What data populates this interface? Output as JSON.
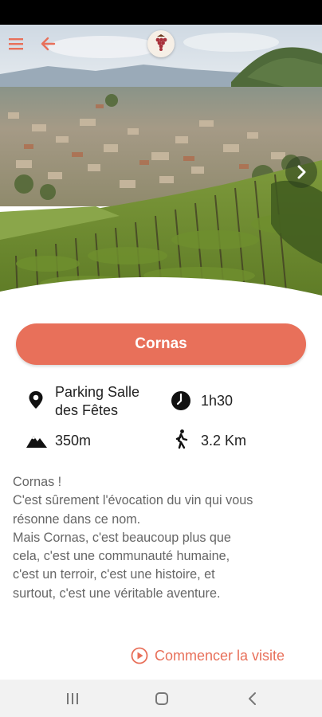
{
  "header": {
    "menu_icon": "hamburger-menu-icon",
    "back_icon": "arrow-left-icon",
    "logo_icon": "grape-logo-icon",
    "next_icon": "chevron-right-icon"
  },
  "colors": {
    "accent": "#e8705a",
    "text_dark": "#222222",
    "text_muted": "#666666"
  },
  "trail": {
    "title": "Cornas",
    "start_point": [
      "Parking Salle",
      "des Fêtes"
    ],
    "duration": "1h30",
    "elevation": "350m",
    "distance": "3.2 Km"
  },
  "description": [
    "Cornas !",
    "C'est sûrement l'évocation du vin qui vous",
    "résonne dans ce nom.",
    "Mais Cornas, c'est beaucoup plus que",
    "cela, c'est une communauté humaine,",
    "c'est un terroir, c'est une histoire, et",
    "surtout, c'est une véritable aventure."
  ],
  "actions": {
    "start_visit": "Commencer la visite"
  }
}
